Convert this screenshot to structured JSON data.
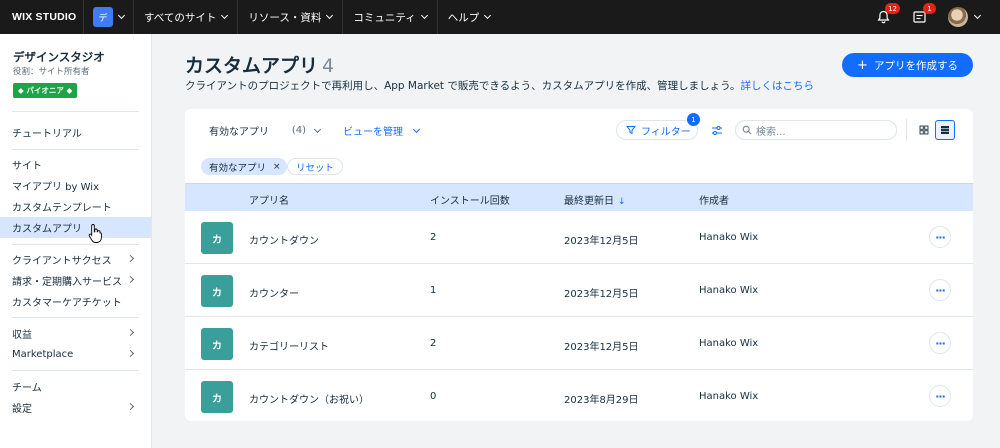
{
  "topbar": {
    "logo": "WIX STUDIO",
    "workspace_badge": "デ",
    "nav": [
      "すべてのサイト",
      "リソース・資料",
      "コミュニティ",
      "ヘルプ"
    ],
    "notifications_count": "12",
    "inbox_count": "1"
  },
  "sidebar": {
    "studio_name": "デザインスタジオ",
    "role": "役割：サイト所有者",
    "badge": "◆ パイオニア ◆",
    "items": [
      {
        "label": "チュートリアル",
        "has_arrow": false,
        "active": false
      },
      {
        "label": "サイト",
        "has_arrow": false,
        "active": false
      },
      {
        "label": "マイアプリ by Wix",
        "has_arrow": false,
        "active": false
      },
      {
        "label": "カスタムテンプレート",
        "has_arrow": false,
        "active": false
      },
      {
        "label": "カスタムアプリ",
        "has_arrow": false,
        "active": true
      },
      {
        "label": "クライアントサクセス",
        "has_arrow": true,
        "active": false
      },
      {
        "label": "請求・定期購入サービス",
        "has_arrow": true,
        "active": false
      },
      {
        "label": "カスタマーケアチケット",
        "has_arrow": false,
        "active": false
      },
      {
        "label": "収益",
        "has_arrow": true,
        "active": false
      },
      {
        "label": "Marketplace",
        "has_arrow": true,
        "active": false
      },
      {
        "label": "チーム",
        "has_arrow": false,
        "active": false
      },
      {
        "label": "設定",
        "has_arrow": true,
        "active": false
      }
    ]
  },
  "main": {
    "title": "カスタムアプリ",
    "count": "4",
    "subtitle": "クライアントのプロジェクトで再利用し、App Market で販売できるよう、カスタムアプリを作成、管理しましょう。",
    "subtitle_link": "詳しくはこちら",
    "create_button": "アプリを作成する",
    "plus_icon": "+"
  },
  "toolbar": {
    "filter_dropdown": "有効なアプリ",
    "filter_dropdown_count": "(4)",
    "manage_views": "ビューを管理",
    "filter_button": "フィルター",
    "filter_badge": "1",
    "search_placeholder": "検索..."
  },
  "chips": {
    "active_filter": "有効なアプリ",
    "remove": "×",
    "reset": "リセット"
  },
  "table": {
    "columns": [
      "アプリ名",
      "インストール回数",
      "最終更新日",
      "作成者"
    ],
    "sort_arrow": "↓",
    "rows": [
      {
        "thumb": "カ",
        "name": "カウントダウン",
        "installs": "2",
        "updated": "2023年12月5日",
        "author": "Hanako Wix"
      },
      {
        "thumb": "カ",
        "name": "カウンター",
        "installs": "1",
        "updated": "2023年12月5日",
        "author": "Hanako Wix"
      },
      {
        "thumb": "カ",
        "name": "カテゴリーリスト",
        "installs": "2",
        "updated": "2023年12月5日",
        "author": "Hanako Wix"
      },
      {
        "thumb": "カ",
        "name": "カウントダウン（お祝い）",
        "installs": "0",
        "updated": "2023年8月29日",
        "author": "Hanako Wix"
      }
    ],
    "more_label": "···"
  },
  "colors": {
    "accent": "#116dff",
    "active_bg": "#d6e6fe",
    "topbar": "#1a1a1a",
    "thumb": "#3a9f9a",
    "badge_green": "#1ea446",
    "notification_red": "#e62214"
  }
}
